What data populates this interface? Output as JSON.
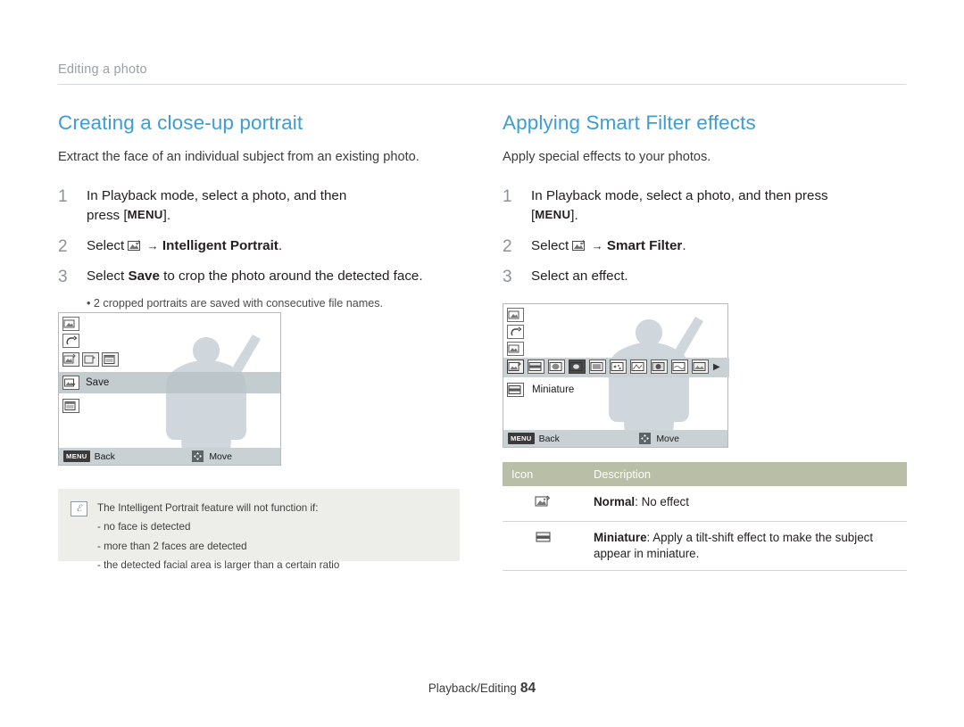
{
  "header": {
    "section_label": "Editing a photo"
  },
  "left": {
    "title": "Creating a close-up portrait",
    "subtitle": "Extract the face of an individual subject from an existing photo.",
    "steps": [
      {
        "num": "1",
        "text_pre": "In Playback mode, select a photo, and then press [",
        "menu": "MENU",
        "text_post": "]."
      },
      {
        "num": "2",
        "text_pre": "Select ",
        "icon": "smart-edit-icon",
        "arrow": "→",
        "bold": "Intelligent Portrait",
        "text_post": "."
      },
      {
        "num": "3",
        "text_pre": "Select ",
        "bold": "Save",
        "text_post": " to crop the photo around the detected face."
      }
    ],
    "note_bullet": "•  2 cropped portraits are saved with consecutive file names.",
    "lcd": {
      "save_label": "Save",
      "menu_tag": "MENU",
      "back_label": "Back",
      "move_label": "Move"
    },
    "notebox": {
      "icon_letter": "ℰ",
      "lines": [
        "The Intelligent Portrait feature will not function if:",
        "-  no face is detected",
        "-  more than 2 faces are detected",
        "-  the detected facial area is larger than a certain ratio"
      ]
    }
  },
  "right": {
    "title": "Applying Smart Filter effects",
    "subtitle": "Apply special effects to your photos.",
    "steps": [
      {
        "num": "1",
        "text_pre": "In Playback mode, select a photo, and then press",
        "menu": "MENU",
        "text_post": "]."
      },
      {
        "num": "2",
        "text_pre": "Select ",
        "icon": "smart-edit-icon",
        "arrow": "→",
        "bold": "Smart Filter",
        "text_post": "."
      },
      {
        "num": "3",
        "text_pre": "Select an effect.",
        "bold": "",
        "text_post": ""
      }
    ],
    "lcd": {
      "caption": "Miniature",
      "menu_tag": "MENU",
      "back_label": "Back",
      "move_label": "Move"
    },
    "table": {
      "headers": [
        "Icon",
        "Description"
      ],
      "rows": [
        {
          "icon": "normal-filter-icon",
          "bold": "Normal",
          "text": ": No effect"
        },
        {
          "icon": "miniature-filter-icon",
          "bold": "Miniature",
          "text": ": Apply a tilt-shift effect to make the subject appear in miniature."
        }
      ]
    }
  },
  "footer": {
    "label": "Playback/Editing",
    "page": "84"
  },
  "colors": {
    "heading": "#3d9dd6",
    "table_header_bg": "#b8bfa6",
    "note_bg": "#ededea",
    "silhouette": "#cfd6dc"
  }
}
